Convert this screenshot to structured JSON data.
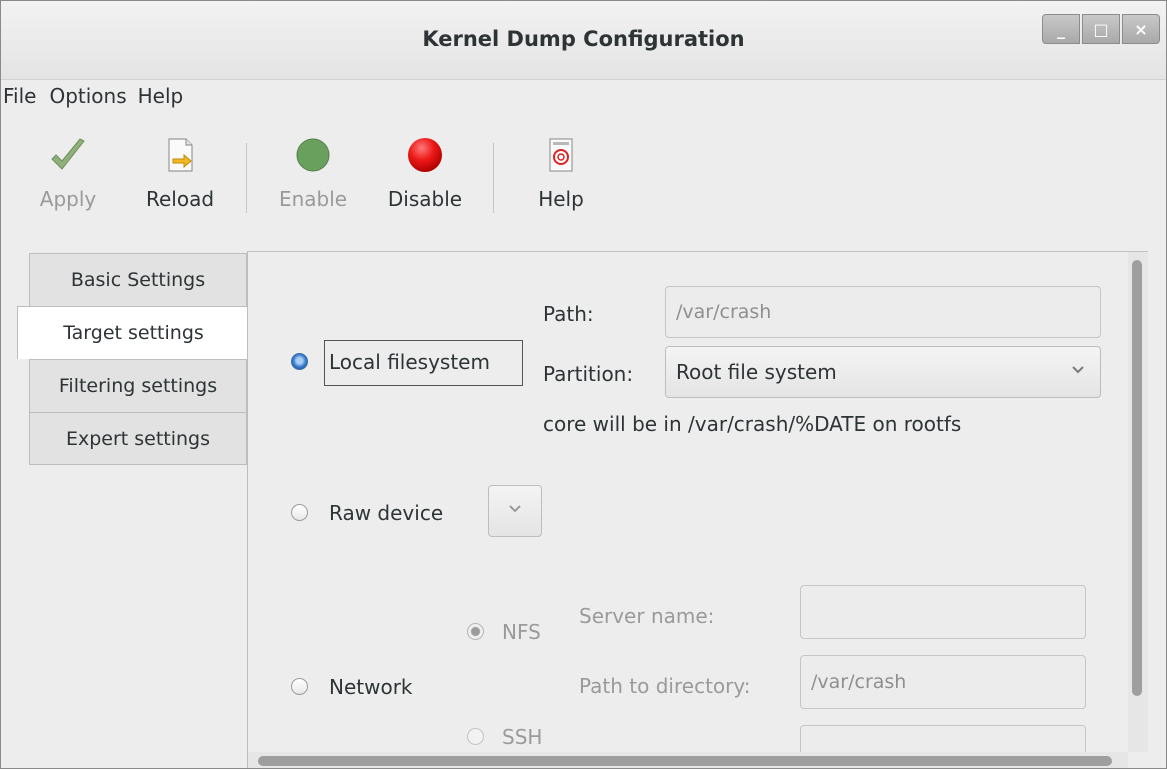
{
  "window": {
    "title": "Kernel Dump Configuration",
    "buttons": [
      "_",
      "□",
      "×"
    ]
  },
  "menu": [
    "File",
    "Options",
    "Help"
  ],
  "toolbar": {
    "apply": "Apply",
    "reload": "Reload",
    "enable": "Enable",
    "disable": "Disable",
    "help": "Help"
  },
  "tabs": [
    "Basic Settings",
    "Target settings",
    "Filtering settings",
    "Expert settings"
  ],
  "target": {
    "local_label": "Local filesystem",
    "path_label": "Path:",
    "path_value": "/var/crash",
    "partition_label": "Partition:",
    "partition_value": "Root file system",
    "core_note": "core will be in /var/crash/%DATE on rootfs",
    "raw_label": "Raw device",
    "network_label": "Network",
    "nfs_label": "NFS",
    "ssh_label": "SSH",
    "server_label": "Server name:",
    "server_value": "",
    "dir_label": "Path to directory:",
    "dir_value": "/var/crash"
  },
  "colors": {
    "accent": "#3d7fd3",
    "disable_red": "#e00000",
    "enable_green": "#6aa05e"
  }
}
